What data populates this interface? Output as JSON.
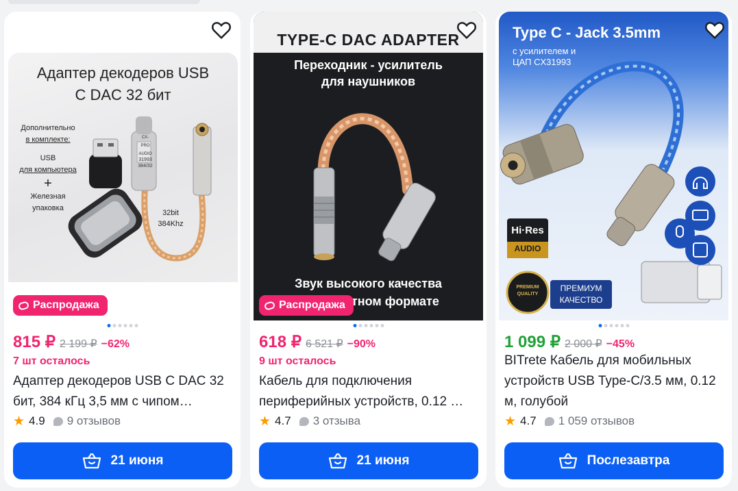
{
  "products": [
    {
      "image_text": {
        "headline_1": "Адаптер декодеров USB",
        "headline_2": "C DAC 32 бит",
        "kit_1": "Дополнительно",
        "kit_2": "в комплекте:",
        "kit_3": "USB",
        "kit_4": "для компьютера",
        "kit_plus": "+",
        "kit_5": "Железная",
        "kit_6": "упаковка",
        "chip_1": "CX-PRO",
        "chip_2": "AUDIO",
        "chip_3": "31993",
        "chip_4": "384/32",
        "spec_1": "32bit",
        "spec_2": "384Khz"
      },
      "badge": "Распродажа",
      "price": "815 ₽",
      "old_price": "2 199 ₽",
      "discount": "−62%",
      "stock": "7 шт осталось",
      "title": "Адаптер декодеров USB C DAC 32 бит, 384 кГц 3,5 мм с чипом…",
      "rating": "4.9",
      "reviews": "9 отзывов",
      "button": "21 июня"
    },
    {
      "image_text": {
        "banner": "TYPE-C DAC ADAPTER",
        "line_1": "Переходник - усилитель",
        "line_2": "для наушников",
        "line_3": "Звук высокого качества",
        "line_4": "в компактном формате"
      },
      "badge": "Распродажа",
      "price": "618 ₽",
      "old_price": "6 521 ₽",
      "discount": "−90%",
      "stock": "9 шт осталось",
      "title": "Кабель для подключения периферийных устройств, 0.12 …",
      "rating": "4.7",
      "reviews": "3 отзыва",
      "button": "21 июня"
    },
    {
      "image_text": {
        "headline": "Type C - Jack 3.5mm",
        "sub_1": "с усилителем и",
        "sub_2": "ЦАП CX31993",
        "hires_1": "Hi·Res",
        "hires_2": "AUDIO",
        "premium_seal_1": "PREMIUM",
        "premium_seal_2": "QUALITY",
        "premium_1": "ПРЕМИУМ",
        "premium_2": "КАЧЕСТВО"
      },
      "price": "1 099 ₽",
      "old_price": "2 000 ₽",
      "discount": "−45%",
      "title": "BITrete Кабель для мобильных устройств USB Type-C/3.5 мм, 0.12 м, голубой",
      "rating": "4.7",
      "reviews": "1 059 отзывов",
      "button": "Послезавтра"
    }
  ],
  "colors": {
    "brand_blue": "#0b5ff5",
    "sale_pink": "#f0246f",
    "price_green": "#21a038",
    "star": "#fc9c00"
  },
  "icons": [
    "heart-icon",
    "basket-icon",
    "star-icon",
    "review-bubble-icon",
    "sale-badge-icon"
  ]
}
